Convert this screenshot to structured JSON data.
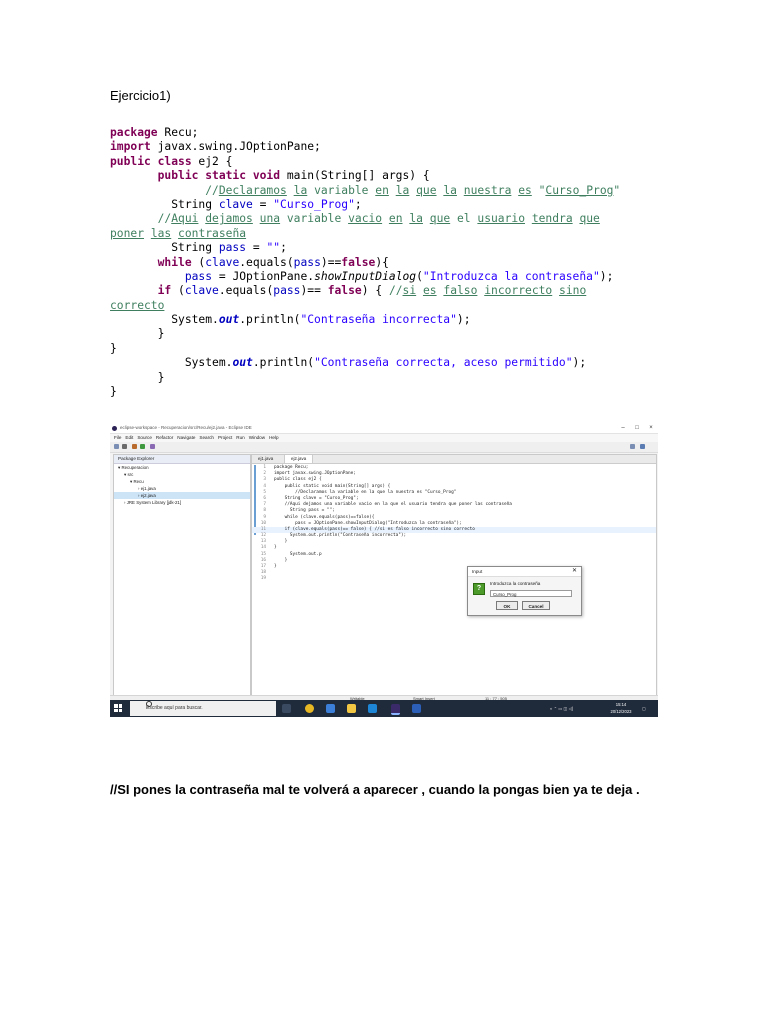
{
  "document": {
    "heading": "Ejercicio1)",
    "note": "//SI pones la contraseña mal te volverá a aparecer , cuando la pongas bien ya te deja ."
  },
  "code": {
    "l1_kw": "package",
    "l1_rest": " Recu;",
    "l2_kw": "import",
    "l2_rest": " javax.swing.JOptionPane;",
    "l3_kw": "public class",
    "l3_rest": " ej2 {",
    "l4_indent": "       ",
    "l4_kw": "public static void",
    "l4_a": " main(String[] ",
    "l4_args": "args",
    "l4_b": ") {",
    "l5_indent": "              ",
    "l5_c1": "//",
    "l5_u1": "Declaramos",
    "l5_s1": " ",
    "l5_u2": "la",
    "l5_s2": " variable ",
    "l5_u3": "en",
    "l5_s3": " ",
    "l5_u4": "la",
    "l5_s4": " ",
    "l5_u5": "que",
    "l5_s5": " ",
    "l5_u6": "la",
    "l5_s6": " ",
    "l5_u7": "nuestra",
    "l5_s7": " ",
    "l5_u8": "es",
    "l5_s8": " \"",
    "l5_u9": "Curso_Prog",
    "l5_s9": "\"",
    "l6_indent": "         ",
    "l6_a": "String ",
    "l6_var": "clave",
    "l6_b": " = ",
    "l6_str": "\"Curso_Prog\"",
    "l6_c": ";",
    "l7_indent": "       ",
    "l7_c1": "//",
    "l7_u1": "Aqui",
    "l7_s1": " ",
    "l7_u2": "dejamos",
    "l7_s2": " ",
    "l7_u3": "una",
    "l7_s3": " variable ",
    "l7_u4": "vacio",
    "l7_s4": " ",
    "l7_u5": "en",
    "l7_s5": " ",
    "l7_u6": "la",
    "l7_s6": " ",
    "l7_u7": "que",
    "l7_s7": " el ",
    "l7_u8": "usuario",
    "l7_s8": " ",
    "l7_u9": "tendra",
    "l7_s9": " ",
    "l7_u10": "que",
    "l8_u1": "poner",
    "l8_s1": " ",
    "l8_u2": "las",
    "l8_s2": " ",
    "l8_u3": "contraseña",
    "l9_indent": "         ",
    "l9_a": "String ",
    "l9_var": "pass",
    "l9_b": " = ",
    "l9_str": "\"\"",
    "l9_c": ";",
    "l10_indent": "       ",
    "l10_kw": "while",
    "l10_a": " (",
    "l10_v1": "clave",
    "l10_b": ".equals(",
    "l10_v2": "pass",
    "l10_c": ")==",
    "l10_kw2": "false",
    "l10_d": "){",
    "l11_indent": "           ",
    "l11_var": "pass",
    "l11_a": " = JOptionPane.",
    "l11_it": "showInputDialog",
    "l11_b": "(",
    "l11_str": "\"Introduzca la contraseña\"",
    "l11_c": ");",
    "l12_indent": "       ",
    "l12_kw": "if",
    "l12_a": " (",
    "l12_v1": "clave",
    "l12_b": ".equals(",
    "l12_v2": "pass",
    "l12_c": ")== ",
    "l12_kw2": "false",
    "l12_d": ") { ",
    "l12_c1": "//",
    "l12_u1": "si",
    "l12_s1": " ",
    "l12_u2": "es",
    "l12_s2": " ",
    "l12_u3": "falso",
    "l12_s3": " ",
    "l12_u4": "incorrecto",
    "l12_s4": " ",
    "l12_u5": "sino",
    "l13_u1": "correcto",
    "l14_indent": "         ",
    "l14_a": "System.",
    "l14_out": "out",
    "l14_b": ".println(",
    "l14_str": "\"Contraseña incorrecta\"",
    "l14_c": ");",
    "l15": "       }",
    "l16": "}",
    "l17_indent": "           ",
    "l17_a": "System.",
    "l17_out": "out",
    "l17_b": ".println(",
    "l17_str": "\"Contraseña correcta, aceso permitido\"",
    "l17_c": ");",
    "l18": "       }",
    "l19": "}"
  },
  "screenshot": {
    "window_title": "eclipse-workspace - Recuperacion/src/Recu/ej2.java - Eclipse IDE",
    "menu": [
      "File",
      "Edit",
      "Source",
      "Refactor",
      "Navigate",
      "Search",
      "Project",
      "Run",
      "Window",
      "Help"
    ],
    "package_explorer": {
      "title": "Package Explorer",
      "items": [
        "Recuperacion",
        "src",
        "Recu",
        "ej1.java",
        "ej2.java",
        "JRE System Library [jdk-21]"
      ]
    },
    "tabs": [
      "ej1.java",
      "ej2.java"
    ],
    "editor_lines": [
      {
        "n": "1",
        "t": "package Recu;"
      },
      {
        "n": "2",
        "t": "import javax.swing.JOptionPane;"
      },
      {
        "n": "3",
        "t": "public class ej2 {"
      },
      {
        "n": "4",
        "t": "    public static void main(String[] args) {"
      },
      {
        "n": "5",
        "t": "        //Declaramos la variable en la que la nuestra es \"Curso_Prog\""
      },
      {
        "n": "6",
        "t": "    String clave = \"Curso_Prog\";"
      },
      {
        "n": "7",
        "t": "    //Aqui dejamos una variable vacio en la que el usuario tendra que poner las contraseña"
      },
      {
        "n": "8",
        "t": "      String pass = \"\";"
      },
      {
        "n": "9",
        "t": "    while (clave.equals(pass)==false){"
      },
      {
        "n": "10",
        "t": "        pass = JOptionPane.showInputDialog(\"Introduzca la contraseña\");"
      },
      {
        "n": "11",
        "t": "    if (clave.equals(pass)== false) { //si es falso incorrecto sino correcto"
      },
      {
        "n": "12",
        "t": "      System.out.println(\"Contraseña incorrecta\");"
      },
      {
        "n": "13",
        "t": "    }"
      },
      {
        "n": "14",
        "t": "}"
      },
      {
        "n": "15",
        "t": "      System.out.p"
      },
      {
        "n": "16",
        "t": "    }"
      },
      {
        "n": "17",
        "t": "}"
      },
      {
        "n": "18",
        "t": ""
      },
      {
        "n": "19",
        "t": ""
      }
    ],
    "dialog": {
      "title": "Input",
      "prompt": "Introduzca la contraseña",
      "value": "Curso_Prog",
      "ok": "OK",
      "cancel": "Cancel"
    },
    "status": {
      "writable": "Writable",
      "mode": "Smart Insert",
      "pos": "11 : 77 : 505"
    },
    "taskbar": {
      "search_placeholder": "Escribe aquí para buscar.",
      "time": "15:14",
      "date": "20/12/2023"
    }
  },
  "colors": {
    "keyword": "#7f0055",
    "comment": "#3f7f5f",
    "string": "#2a00ff",
    "field": "#0000c0"
  }
}
